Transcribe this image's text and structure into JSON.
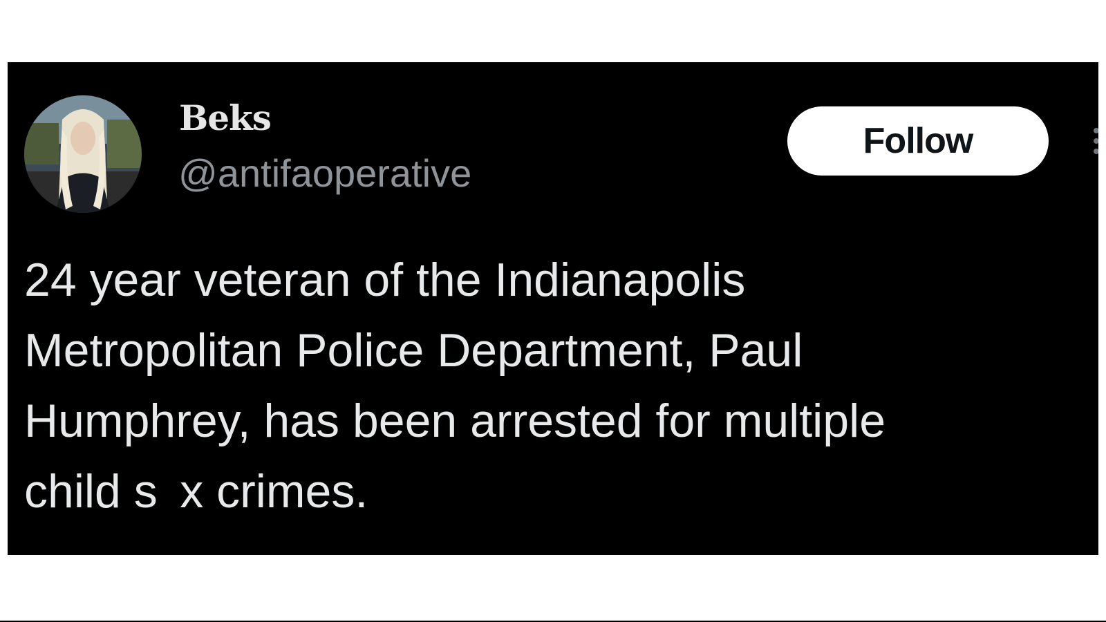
{
  "user": {
    "display_name": "Beks",
    "handle": "@antifaoperative",
    "avatar_icon": "profile-photo"
  },
  "actions": {
    "follow_label": "Follow",
    "more_icon": "more-options-icon"
  },
  "tweet": {
    "text": "24 year veteran of the Indianapolis\nMetropolitan Police Department, Paul\nHumphrey, has been arrested for multiple\nchild s  x crimes."
  },
  "colors": {
    "card_background": "#000000",
    "page_background": "#ffffff",
    "name_color": "#e6e6e6",
    "handle_color": "#8f9499",
    "text_color": "#e7e9ea",
    "button_background": "#ffffff",
    "button_text": "#0f1419"
  }
}
